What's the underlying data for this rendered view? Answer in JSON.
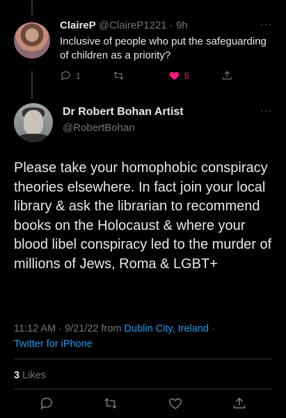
{
  "reply_tweet": {
    "display_name": "ClaireP",
    "handle": "@ClaireP1221",
    "separator": "·",
    "age": "9h",
    "text": "Inclusive of people who put the safeguarding of children as a priority?",
    "reply_count": "1",
    "retweet_count": "",
    "like_count": "5",
    "more_glyph": "···"
  },
  "main_tweet": {
    "display_name": "Dr Robert Bohan Artist",
    "handle": "@RobertBohan",
    "more_glyph": "···",
    "text": "Please take your homophobic conspiracy theories elsewhere. In fact join your local library & ask the librarian to recommend books on the Holocaust & where your blood libel conspiracy led to the murder of millions of Jews, Roma & LGBT+",
    "time": "11:12 AM",
    "dot1": " · ",
    "date": "9/21/22",
    "from_word": " from ",
    "location": "Dublin City, Ireland",
    "dot2": " ·",
    "client": "Twitter for iPhone",
    "likes_count": "3",
    "likes_label": " Likes"
  },
  "icons": {
    "reply": "reply-bubble-icon",
    "retweet": "retweet-icon",
    "like": "heart-icon",
    "share": "share-icon"
  },
  "colors": {
    "background": "#000000",
    "text": "#e7e9ea",
    "muted": "#71767b",
    "link": "#1d9bf0",
    "like": "#f91880"
  }
}
